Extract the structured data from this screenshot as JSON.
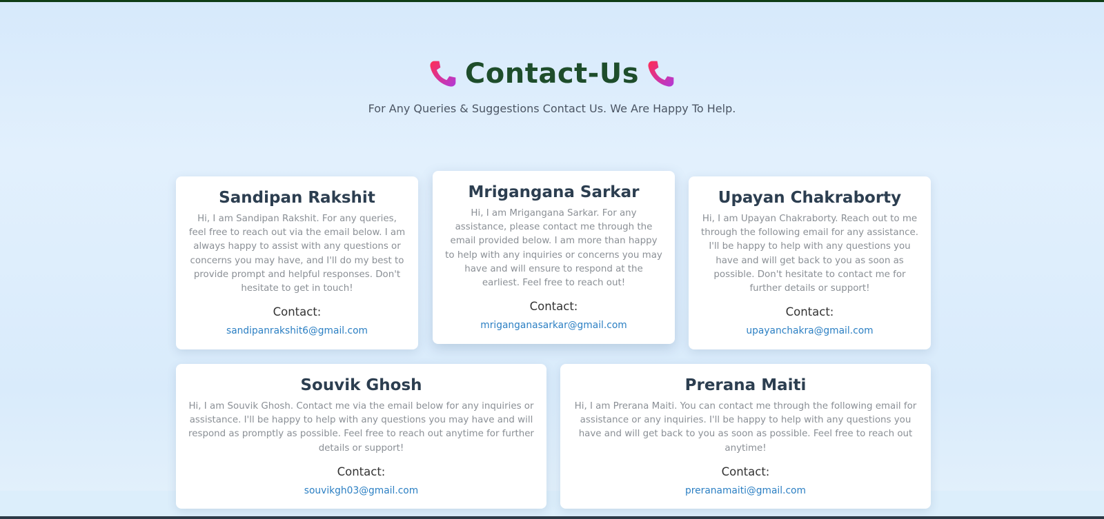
{
  "hero": {
    "title": "Contact-Us",
    "subtitle": "For Any Queries & Suggestions Contact Us. We Are Happy To Help.",
    "icon": "phone-icon"
  },
  "contact_label": "Contact:",
  "colors": {
    "title": "#1e4d2b",
    "email_link": "#2b7fc3",
    "name": "#2c3e50",
    "phone_gradient": [
      "#ff2d55",
      "#b03ad9"
    ]
  },
  "cards": [
    {
      "name": "Sandipan Rakshit",
      "bio": "Hi, I am Sandipan Rakshit. For any queries, feel free to reach out via the email below. I am always happy to assist with any questions or concerns you may have, and I'll do my best to provide prompt and helpful responses. Don't hesitate to get in touch!",
      "email": "sandipanrakshit6@gmail.com"
    },
    {
      "name": "Mrigangana Sarkar",
      "bio": "Hi, I am Mrigangana Sarkar. For any assistance, please contact me through the email provided below. I am more than happy to help with any inquiries or concerns you may have and will ensure to respond at the earliest. Feel free to reach out!",
      "email": "mriganganasarkar@gmail.com"
    },
    {
      "name": "Upayan Chakraborty",
      "bio": "Hi, I am Upayan Chakraborty. Reach out to me through the following email for any assistance. I'll be happy to help with any questions you have and will get back to you as soon as possible. Don't hesitate to contact me for further details or support!",
      "email": "upayanchakra@gmail.com"
    },
    {
      "name": "Souvik Ghosh",
      "bio": "Hi, I am Souvik Ghosh. Contact me via the email below for any inquiries or assistance. I'll be happy to help with any questions you may have and will respond as promptly as possible. Feel free to reach out anytime for further details or support!",
      "email": "souvikgh03@gmail.com"
    },
    {
      "name": "Prerana Maiti",
      "bio": "Hi, I am Prerana Maiti. You can contact me through the following email for assistance or any inquiries. I'll be happy to help with any questions you have and will get back to you as soon as possible. Feel free to reach out anytime!",
      "email": "preranamaiti@gmail.com"
    }
  ]
}
